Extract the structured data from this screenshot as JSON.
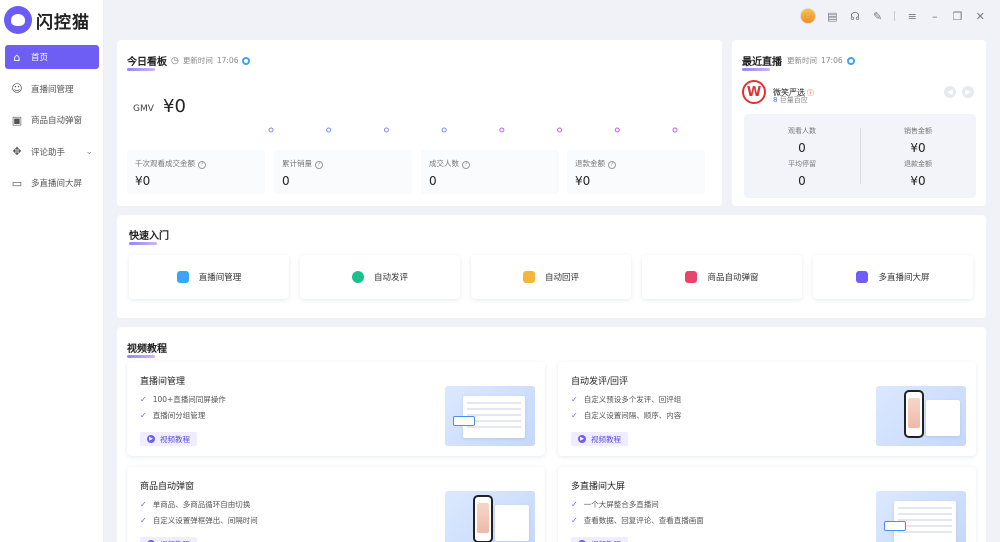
{
  "app": {
    "name": "闪控猫"
  },
  "sidebar": {
    "items": [
      {
        "label": "首页",
        "icon": "home-icon",
        "active": true
      },
      {
        "label": "直播间管理",
        "icon": "user-icon"
      },
      {
        "label": "商品自动弹窗",
        "icon": "window-icon"
      },
      {
        "label": "评论助手",
        "icon": "puzzle-icon",
        "expandable": true
      },
      {
        "label": "多直播间大屏",
        "icon": "screen-icon"
      }
    ]
  },
  "today": {
    "title": "今日看板",
    "update_label": "更新时间",
    "update_time": "17:06",
    "gmv_label": "GMV",
    "gmv_value": "¥0",
    "trend_points": [
      0,
      0,
      0,
      0,
      0,
      0,
      0,
      0
    ],
    "stats": [
      {
        "label": "千次观看成交金额",
        "value": "¥0"
      },
      {
        "label": "累计销量",
        "value": "0"
      },
      {
        "label": "成交人数",
        "value": "0"
      },
      {
        "label": "退款金额",
        "value": "¥0"
      }
    ]
  },
  "recent": {
    "title": "最近直播",
    "update_label": "更新时间",
    "update_time": "17:06",
    "room_name": "微笑严选",
    "room_logo": "W",
    "room_platform": "巨量百应",
    "stats": [
      {
        "label": "观看人数",
        "value": "0"
      },
      {
        "label": "销售金额",
        "value": "¥0"
      },
      {
        "label": "平均停留",
        "value": "0"
      },
      {
        "label": "退款金额",
        "value": "¥0"
      }
    ]
  },
  "quick": {
    "title": "快速入门",
    "items": [
      {
        "label": "直播间管理",
        "color": "#3aa4f5"
      },
      {
        "label": "自动发评",
        "color": "#19c08a"
      },
      {
        "label": "自动回评",
        "color": "#f5b53a"
      },
      {
        "label": "商品自动弹窗",
        "color": "#e8456b"
      },
      {
        "label": "多直播间大屏",
        "color": "#6e5ef3"
      }
    ]
  },
  "tutorials": {
    "title": "视频教程",
    "button_label": "视频教程",
    "items": [
      {
        "title": "直播间管理",
        "bullets": [
          "100+直播间同屏操作",
          "直播间分组管理"
        ],
        "thumb": "window"
      },
      {
        "title": "自动发评/回评",
        "bullets": [
          "自定义预设多个发评、回评组",
          "自定义设置间隔、顺序、内容"
        ],
        "thumb": "phone"
      },
      {
        "title": "商品自动弹窗",
        "bullets": [
          "单商品、多商品循环自由切换",
          "自定义设置弹框弹出、间隔时间"
        ],
        "thumb": "phone"
      },
      {
        "title": "多直播间大屏",
        "bullets": [
          "一个大屏整合多直播间",
          "查看数据、回复评论、查看直播画面"
        ],
        "thumb": "window"
      }
    ]
  }
}
